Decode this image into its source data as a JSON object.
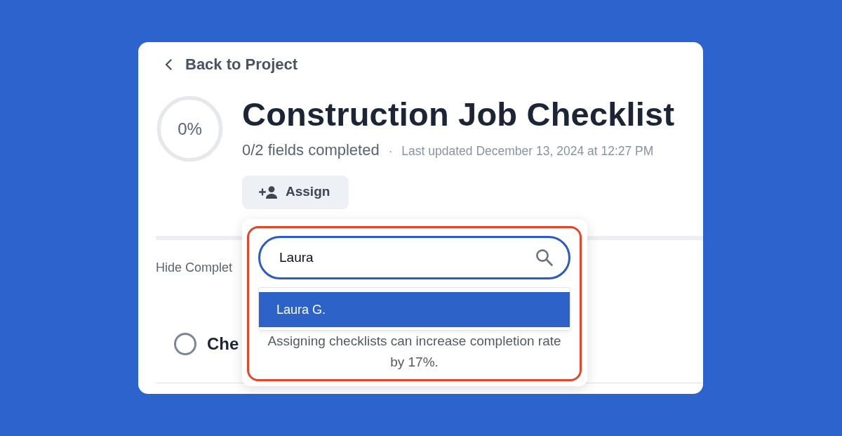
{
  "back_link": {
    "label": "Back to Project"
  },
  "progress": {
    "label": "0%",
    "level": 0
  },
  "title": "Construction Job Checklist",
  "summary": "0/2 fields completed",
  "meta_separator": "·",
  "last_updated": "Last updated December 13, 2024 at 12:27 PM",
  "assign_button": {
    "label": "Assign"
  },
  "filter_label": "Hide Complet",
  "checklist_items": [
    {
      "label": "Che",
      "checked": false
    }
  ],
  "assign_popup": {
    "highlighted": true,
    "search": {
      "value": "Laura"
    },
    "results": [
      {
        "label": "Laura G.",
        "selected": true
      }
    ],
    "hint": "Assigning checklists can increase completion rate by 17%."
  }
}
